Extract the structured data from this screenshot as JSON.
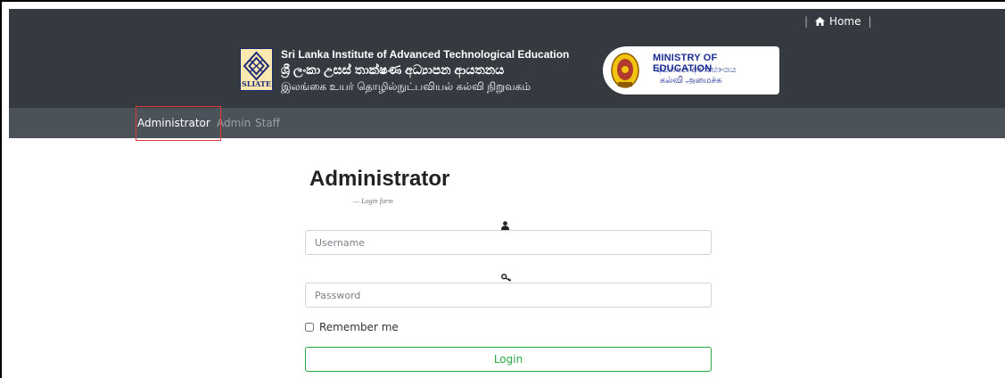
{
  "topbar": {
    "separator_left": "|",
    "home_label": "Home",
    "home_icon": "home-icon",
    "separator_right": "|"
  },
  "banner": {
    "logo_text": "SLIATE",
    "institute_en": "Sri Lanka Institute of Advanced Technological Education",
    "institute_si": "ශ්‍රී ලංකා උසස් තාක්ෂණ අධ්‍යාපන ආයතනය",
    "institute_ta": "இலங்கை உயர் தொழில்நுட்பவியல் கல்வி நிறுவகம்",
    "ministry_en": "MINISTRY OF EDUCATION",
    "ministry_si": "අධ්‍යාපන අමාත්‍යාංශය",
    "ministry_ta": "கல்வி அமைச்சு"
  },
  "nav": {
    "items": [
      {
        "label": "Administrator",
        "active": true
      },
      {
        "label": "Admin",
        "active": false
      },
      {
        "label": "Staff",
        "active": false
      }
    ]
  },
  "form": {
    "title": "Administrator",
    "subtitle": "— Login form",
    "username_icon": "user-icon",
    "username_placeholder": "Username",
    "username_value": "",
    "password_icon": "key-icon",
    "password_placeholder": "Password",
    "password_value": "",
    "remember_label": "Remember me",
    "remember_checked": false,
    "login_label": "Login"
  },
  "colors": {
    "header_bg": "#343a40",
    "nav_bg": "#4b5259",
    "login_accent": "#28a745",
    "highlight": "#e53935",
    "ministry_text": "#1a2b8f"
  }
}
